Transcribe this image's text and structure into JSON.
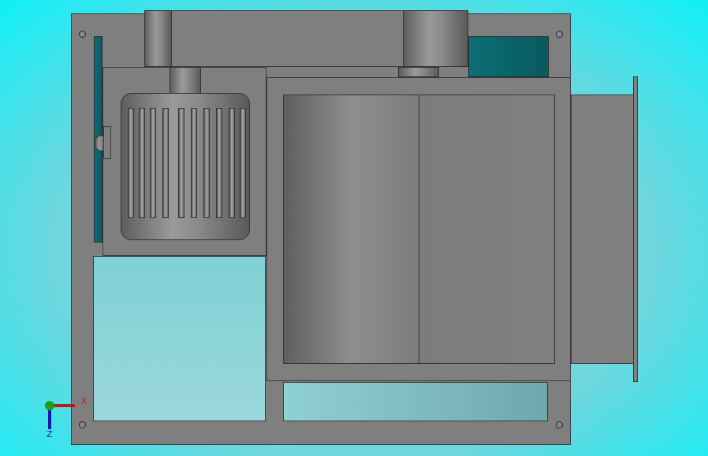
{
  "triad": {
    "x_label": "X",
    "z_label": "Z"
  },
  "colors": {
    "x_axis": "#c01818",
    "y_axis": "#18a018",
    "z_axis": "#1818b0"
  }
}
